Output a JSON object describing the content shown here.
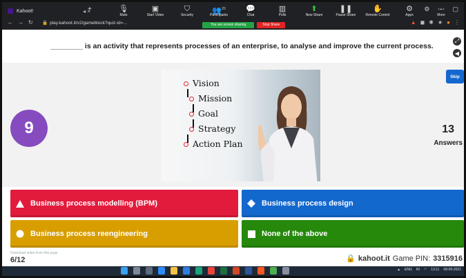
{
  "browser": {
    "tab_title": "Kahoot!",
    "url": "play.kahoot.it/v2/gameblock?quiz-id=...",
    "zoom_toolbar": {
      "items": [
        {
          "label": "Mute",
          "icon": "mic-icon"
        },
        {
          "label": "Start Video",
          "icon": "video-off-icon"
        },
        {
          "label": "Security",
          "icon": "shield-icon"
        },
        {
          "label": "Participants",
          "icon": "participants-icon",
          "count": "20"
        },
        {
          "label": "Chat",
          "icon": "chat-icon"
        },
        {
          "label": "Polls",
          "icon": "polls-icon"
        },
        {
          "label": "New Share",
          "icon": "share-screen-icon"
        },
        {
          "label": "Pause Share",
          "icon": "pause-icon"
        },
        {
          "label": "Remote Control",
          "icon": "remote-control-icon"
        },
        {
          "label": "Apps",
          "icon": "apps-icon"
        },
        {
          "label": "More",
          "icon": "more-icon"
        }
      ],
      "sharing_message": "You are screen sharing",
      "stop_share_label": "Stop Share"
    }
  },
  "question": {
    "text": "________ is an activity that represents processes of an enterprise, to analyse and improve the current process."
  },
  "timer": "9",
  "skip_label": "Skip",
  "answer_count": {
    "number": "13",
    "label": "Answers"
  },
  "image": {
    "steps": [
      "Vision",
      "Mission",
      "Goal",
      "Strategy",
      "Action Plan"
    ]
  },
  "answers": [
    {
      "label": "Business process modelling (BPM)",
      "shape": "triangle-icon",
      "color": "#e21b3c"
    },
    {
      "label": "Business process design",
      "shape": "diamond-icon",
      "color": "#1368ce"
    },
    {
      "label": "Business process reengineering",
      "shape": "circle-icon",
      "color": "#d89e00"
    },
    {
      "label": "None of the above",
      "shape": "square-icon",
      "color": "#26890c"
    }
  ],
  "footer": {
    "progress": "6/12",
    "download_hint": "Download video from this page",
    "site": "kahoot.it",
    "game_pin_label": "Game PIN:",
    "game_pin": "3315916"
  },
  "taskbar": {
    "language": "ENG",
    "region": "IN",
    "time": "13:11",
    "date": "08-09-2021"
  }
}
